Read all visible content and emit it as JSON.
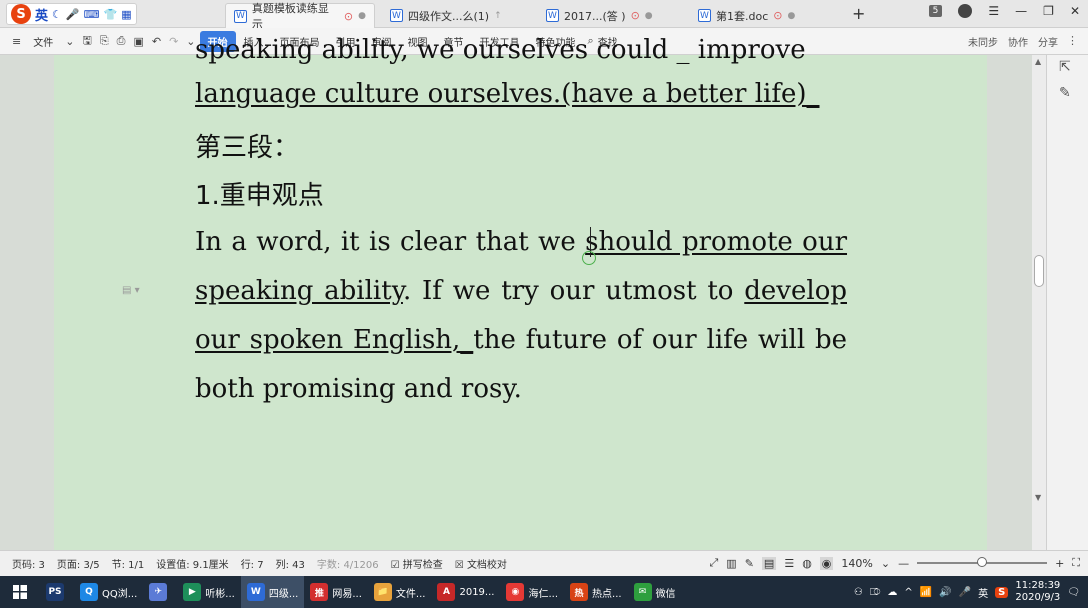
{
  "ime": {
    "lang": "英",
    "icons": [
      "moon-icon",
      "mic-icon",
      "keyboard-icon",
      "shirt-icon",
      "grid-icon"
    ]
  },
  "tabs": [
    {
      "label": "真题模板读练显示",
      "active": true
    },
    {
      "label": "四级作文...么(1)",
      "active": false
    },
    {
      "label": "2017...(答  )",
      "active": false
    },
    {
      "label": "第1套.doc",
      "active": false
    }
  ],
  "window": {
    "badge": "5"
  },
  "ribbon": {
    "file": "文件",
    "tabs": [
      "开始",
      "插入",
      "页面布局",
      "引用",
      "审阅",
      "视图",
      "章节",
      "开发工具",
      "特色功能"
    ],
    "search": "查找",
    "right": [
      "未同步",
      "协作",
      "分享"
    ]
  },
  "document": {
    "lines": [
      {
        "text": "speaking ability, we ourselves could _ improve",
        "partial": true
      },
      {
        "text": "language culture ourselves.(have a better life)_",
        "underline": true
      },
      {
        "text": "第三段："
      },
      {
        "text": "1.重申观点"
      }
    ],
    "para": [
      {
        "segments": [
          {
            "t": "In a word, it is clear that we "
          },
          {
            "t": "should promote our",
            "u": true
          }
        ]
      },
      {
        "segments": [
          {
            "t": "speaking ability",
            "u": true
          },
          {
            "t": ". If we try our utmost to "
          },
          {
            "t": "develop",
            "u": true
          }
        ]
      },
      {
        "segments": [
          {
            "t": "our spoken English,_",
            "u": true
          },
          {
            "t": "the future of our life will be"
          }
        ]
      },
      {
        "segments": [
          {
            "t": "both promising and rosy."
          }
        ],
        "last": true
      }
    ]
  },
  "statusbar": {
    "page": "页码: 3",
    "pages": "页面: 3/5",
    "section": "节: 1/1",
    "position": "设置值: 9.1厘米",
    "row": "行: 7",
    "col": "列: 43",
    "words": "字数: 4/1206",
    "spell": "拼写检查",
    "proof": "文档校对",
    "zoom": "140%"
  },
  "taskbar": {
    "apps": [
      {
        "label": "",
        "icon": "PS",
        "color": "#1c3a6e"
      },
      {
        "label": "QQ浏...",
        "icon": "Q",
        "color": "#1e88e5"
      },
      {
        "label": "",
        "icon": "✈",
        "color": "#5b7bd6"
      },
      {
        "label": "听彬...",
        "icon": "▶",
        "color": "#1e8f5a"
      },
      {
        "label": "四级...",
        "icon": "W",
        "color": "#2e6bd6",
        "active": true
      },
      {
        "label": "网易...",
        "icon": "推",
        "color": "#d32f2f"
      },
      {
        "label": "文件...",
        "icon": "📁",
        "color": "#e8a33c"
      },
      {
        "label": "2019...",
        "icon": "A",
        "color": "#c62828"
      },
      {
        "label": "海仁...",
        "icon": "◉",
        "color": "#e53935"
      },
      {
        "label": "热点...",
        "icon": "热",
        "color": "#d84315"
      },
      {
        "label": "微信",
        "icon": "✉",
        "color": "#2e9f3e"
      }
    ],
    "tray_lang": "英",
    "time": "11:28:39",
    "date": "2020/9/3"
  }
}
